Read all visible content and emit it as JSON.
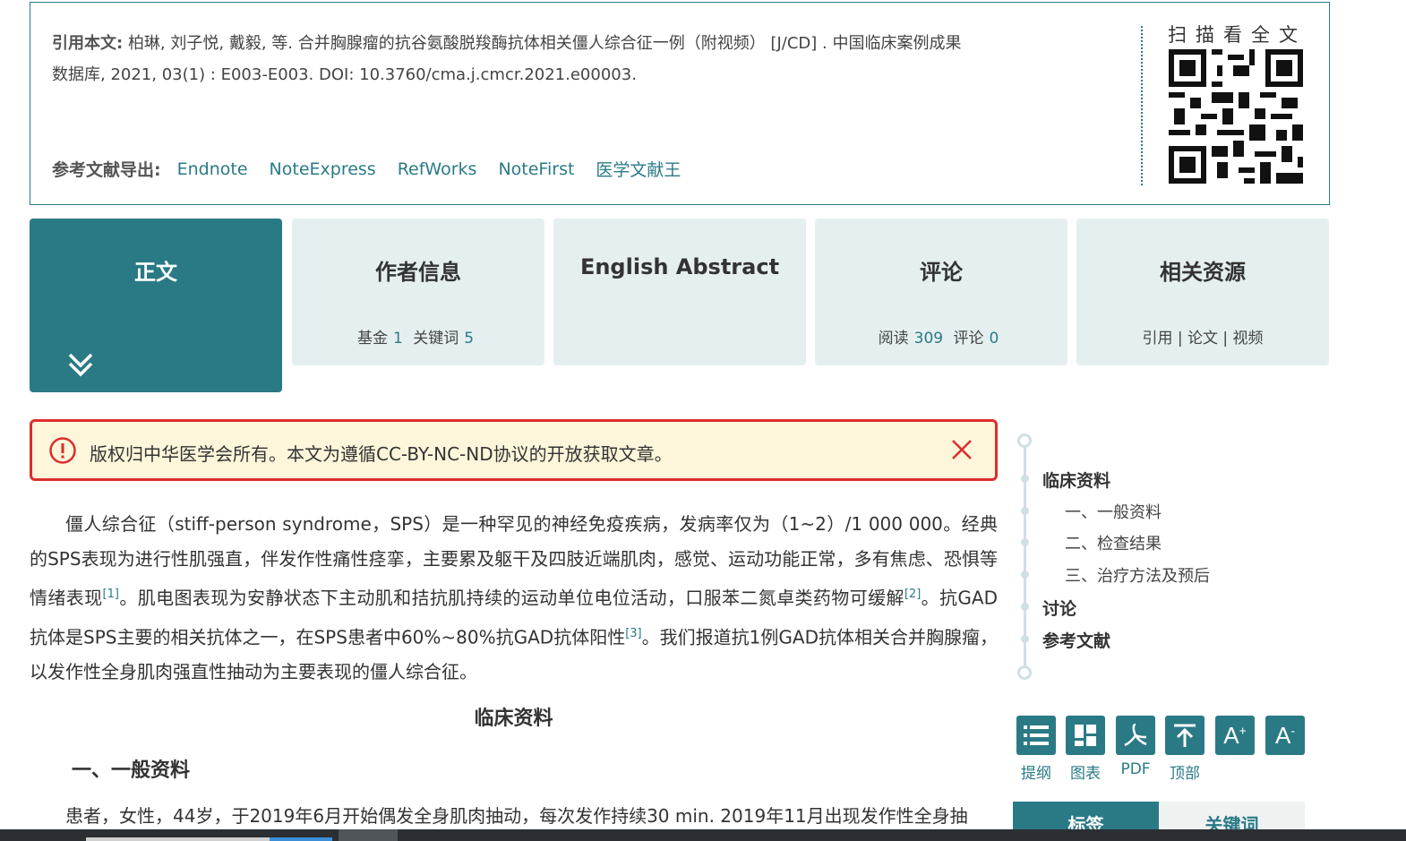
{
  "citation": {
    "label": "引用本文:",
    "text_line1": "柏琳, 刘子悦, 戴毅, 等.  合并胸腺瘤的抗谷氨酸脱羧酶抗体相关僵人综合征一例（附视频） [J/CD] . 中国临床案例成果",
    "text_line2": "数据库, 2021, 03(1) : E003-E003. DOI: 10.3760/cma.j.cmcr.2021.e00003.",
    "export_label": "参考文献导出:",
    "export_links": [
      "Endnote",
      "NoteExpress",
      "RefWorks",
      "NoteFirst",
      "医学文献王"
    ],
    "qr_title": "扫描看全文"
  },
  "tabs": [
    {
      "title": "正文",
      "active": true
    },
    {
      "title": "作者信息",
      "sub": [
        {
          "label": "基金",
          "value": "1"
        },
        {
          "label": "关键词",
          "value": "5"
        }
      ]
    },
    {
      "title": "English Abstract"
    },
    {
      "title": "评论",
      "sub": [
        {
          "label": "阅读",
          "value": "309"
        },
        {
          "label": "评论",
          "value": "0"
        }
      ]
    },
    {
      "title": "相关资源",
      "sub_text": "引用 | 论文 | 视频"
    }
  ],
  "notice": {
    "text": "版权归中华医学会所有。本文为遵循CC-BY-NC-ND协议的开放获取文章。"
  },
  "article": {
    "para1_a": "僵人综合征（stiff-person syndrome，SPS）是一种罕见的神经免疫疾病，发病率仅为（1~2）/1 000 000。经典的SPS表现为进行性肌强直，伴发作性痛性痉挛，主要累及躯干及四肢近端肌肉，感觉、运动功能正常，多有焦虑、恐惧等情绪表现",
    "ref1": "[1]",
    "para1_b": "。肌电图表现为安静状态下主动肌和拮抗肌持续的运动单位电位活动，口服苯二氮卓类药物可缓解",
    "ref2": "[2]",
    "para1_c": "。抗GAD抗体是SPS主要的相关抗体之一，在SPS患者中60%~80%抗GAD抗体阳性",
    "ref3": "[3]",
    "para1_d": "。我们报道抗1例GAD抗体相关合并胸腺瘤，以发作性全身肌肉强直性抽动为主要表现的僵人综合征。",
    "section_title": "临床资料",
    "subsection_title": "一、一般资料",
    "para2": "患者，女性，44岁，于2019年6月开始偶发全身肌肉抽动，每次发作持续30 min. 2019年11月出现发作性全身抽"
  },
  "outline": {
    "items": [
      {
        "label": "临床资料",
        "level": 1
      },
      {
        "label": "一、一般资料",
        "level": 2
      },
      {
        "label": "二、检查结果",
        "level": 2
      },
      {
        "label": "三、治疗方法及预后",
        "level": 2
      },
      {
        "label": "讨论",
        "level": 1
      },
      {
        "label": "参考文献",
        "level": 1
      }
    ]
  },
  "tools": [
    {
      "label": "提纲",
      "icon": "list-icon"
    },
    {
      "label": "图表",
      "icon": "chart-grid-icon"
    },
    {
      "label": "PDF",
      "icon": "pdf-icon"
    },
    {
      "label": "顶部",
      "icon": "back-to-top-icon"
    },
    {
      "label": "",
      "icon": "font-increase-icon",
      "glyph": "A+"
    },
    {
      "label": "",
      "icon": "font-decrease-icon",
      "glyph": "A-"
    }
  ],
  "bottom_tabs": [
    "标签",
    "关键词"
  ]
}
